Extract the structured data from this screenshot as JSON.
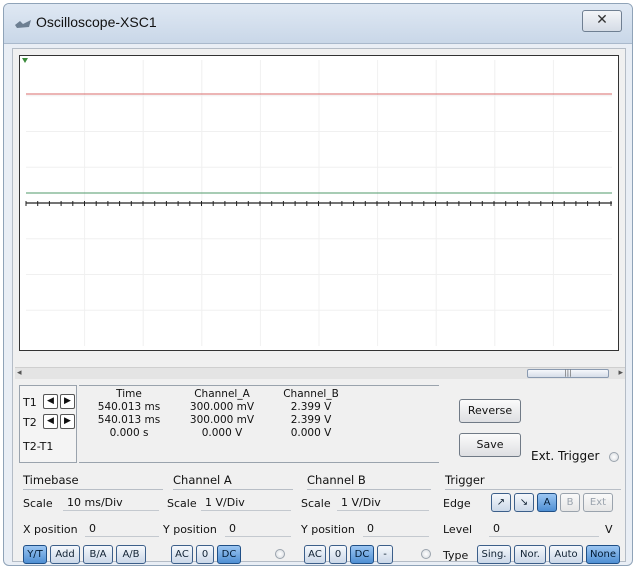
{
  "window": {
    "title": "Oscilloscope-XSC1",
    "close_label": "✕"
  },
  "cursors": {
    "t1_label": "T1",
    "t2_label": "T2",
    "diff_label": "T2-T1",
    "left_arrow": "◆",
    "right_arrow": "➔"
  },
  "readout": {
    "headers": {
      "time": "Time",
      "channel_a": "Channel_A",
      "channel_b": "Channel_B"
    },
    "t1": {
      "time": "540.013 ms",
      "a": "300.000 mV",
      "b": "2.399 V"
    },
    "t2": {
      "time": "540.013 ms",
      "a": "300.000 mV",
      "b": "2.399 V"
    },
    "diff": {
      "time": "0.000 s",
      "a": "0.000 V",
      "b": "0.000 V"
    }
  },
  "buttons": {
    "reverse": "Reverse",
    "save": "Save",
    "ext_trigger": "Ext. Trigger"
  },
  "timebase": {
    "title": "Timebase",
    "scale_label": "Scale",
    "scale_value": "10 ms/Div",
    "xpos_label": "X position",
    "xpos_value": "0",
    "modes": [
      "Y/T",
      "Add",
      "B/A",
      "A/B"
    ],
    "active_mode": "Y/T"
  },
  "channel_a": {
    "title": "Channel A",
    "scale_label": "Scale",
    "scale_value": "1  V/Div",
    "ypos_label": "Y position",
    "ypos_value": "0",
    "coupling": [
      "AC",
      "0",
      "DC"
    ],
    "active_coupling": "DC"
  },
  "channel_b": {
    "title": "Channel B",
    "scale_label": "Scale",
    "scale_value": "1  V/Div",
    "ypos_label": "Y position",
    "ypos_value": "0",
    "coupling": [
      "AC",
      "0",
      "DC",
      "-"
    ],
    "active_coupling": "DC"
  },
  "trigger": {
    "title": "Trigger",
    "edge_label": "Edge",
    "edge_buttons": [
      "↗",
      "↘",
      "A",
      "B",
      "Ext"
    ],
    "active_edge": "A",
    "level_label": "Level",
    "level_value": "0",
    "level_unit": "V",
    "type_label": "Type",
    "types": [
      "Sing.",
      "Nor.",
      "Auto",
      "None"
    ],
    "active_type": "None"
  },
  "colors": {
    "trace_red": "#d86b6b",
    "trace_green": "#4f9a6a",
    "trace_black": "#222222",
    "accent": "#4f8fd3"
  },
  "traces": {
    "channel_a_level_v": 0.3,
    "channel_b_level_v": 2.399,
    "red_marker_level": "2.399 V"
  }
}
